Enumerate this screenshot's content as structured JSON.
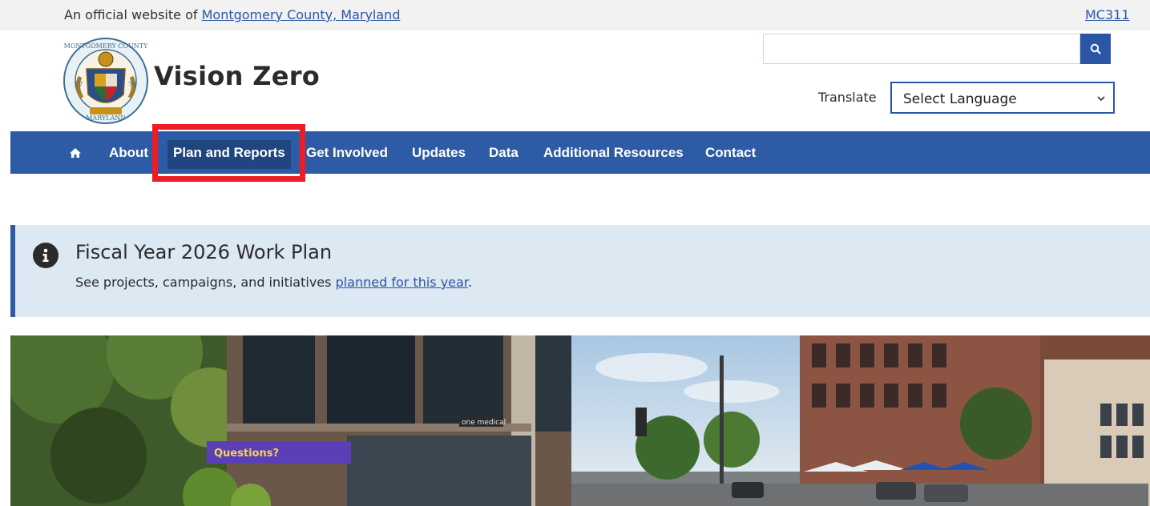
{
  "banner": {
    "prefix": "An official website of ",
    "county_link": "Montgomery County, Maryland",
    "mc311": "MC311"
  },
  "header": {
    "site_title": "Vision Zero",
    "search": {
      "placeholder": ""
    },
    "translate_label": "Translate",
    "language_select": "Select Language"
  },
  "seal": {
    "top_text": "MONTGOMERY COUNTY",
    "bottom_text": "MARYLAND",
    "left_number": "17",
    "right_number": "76"
  },
  "nav": {
    "items": [
      {
        "label": "About"
      },
      {
        "label": "Plan and Reports"
      },
      {
        "label": "Get Involved"
      },
      {
        "label": "Updates"
      },
      {
        "label": "Data"
      },
      {
        "label": "Additional Resources"
      },
      {
        "label": "Contact"
      }
    ]
  },
  "alert": {
    "title": "Fiscal Year 2026 Work Plan",
    "text_prefix": "See projects, campaigns, and initiatives ",
    "link": "planned for this year",
    "text_suffix": "."
  },
  "hero": {
    "sign_text": "Questions?",
    "storefront_text": "one medical"
  },
  "colors": {
    "nav_blue": "#2e5ba6",
    "link_blue": "#2a56a5",
    "alert_bg": "#dce8f2",
    "highlight_red": "#ee1c24"
  }
}
